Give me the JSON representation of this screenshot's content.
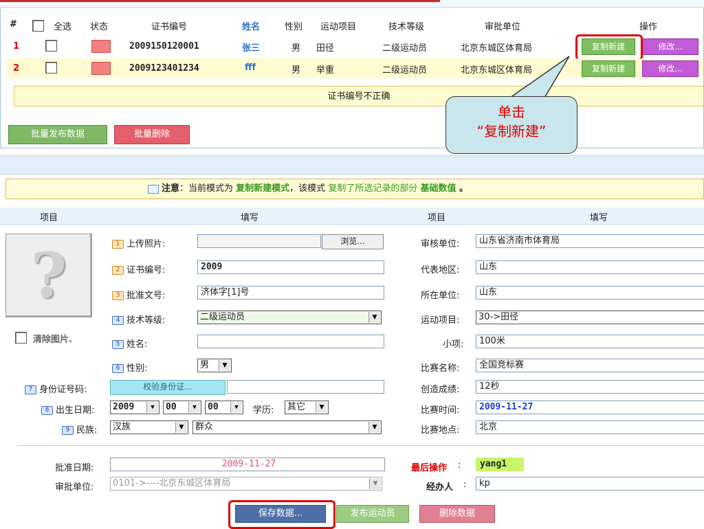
{
  "list": {
    "headers": [
      "#",
      "全选",
      "状态",
      "证书编号",
      "姓名",
      "性别",
      "运动项目",
      "技术等级",
      "审批单位",
      "操作"
    ],
    "rows": [
      {
        "index": "1",
        "cert": "2009150120001",
        "name": "张三",
        "gender": "男",
        "sport": "田径",
        "level": "二级运动员",
        "unit": "北京东城区体育局",
        "copy_btn": "复制新建",
        "edit_btn": "修改..."
      },
      {
        "index": "2",
        "cert": "2009123401234",
        "name": "fff",
        "gender": "男",
        "sport": "举重",
        "level": "二级运动员",
        "unit": "北京东城区体育局",
        "copy_btn": "复制新建",
        "edit_btn": "修改..."
      }
    ],
    "error_message": "证书编号不正确",
    "batch_publish": "批量发布数据",
    "batch_delete": "批量删除"
  },
  "callout": {
    "line1": "单击",
    "line2": "“复制新建”"
  },
  "notice": {
    "prefix": "注意",
    "text1": "：当前模式为 ",
    "mode": "复制新建模式",
    "text2": "，该模式 ",
    "text3": "复制了所选记录的部分 ",
    "highlight": "基础数值",
    "suffix": " 。"
  },
  "form_header": {
    "item_left": "项目",
    "fill_left": "填写",
    "item_right": "项目",
    "fill_right": "填写"
  },
  "form": {
    "upload_label": "上传照片:",
    "browse": "浏览...",
    "cert_label": "证书编号:",
    "cert_value": "2009",
    "approval_no_label": "批准文号:",
    "approval_no_value": "济体字[1]号",
    "tech_level_label": "技术等级:",
    "tech_level_value": "二级运动员",
    "clear_photo": "清除图片.",
    "name_label": "姓名:",
    "name_value": "",
    "gender_label": "性别:",
    "gender_value": "男",
    "id_label": "身份证号码:",
    "verify_btn": "校验身份证...",
    "birth_label": "出生日期:",
    "birth_year": "2009",
    "birth_month": "00",
    "birth_day": "00",
    "edu_label": "学历:",
    "edu_value": "其它",
    "ethnic_label": "民族:",
    "ethnic_value": "汉族",
    "political_value": "群众",
    "review_unit_label": "审核单位:",
    "review_unit_value": "山东省济南市体育局",
    "region_label": "代表地区:",
    "region_value": "山东",
    "org_label": "所在单位:",
    "org_value": "山东",
    "sport_label": "运动项目:",
    "sport_value": "30->田径",
    "sub_item_label": "小项:",
    "sub_item_value": "100米",
    "match_label": "比赛名称:",
    "match_value": "全国竞标赛",
    "score_label": "创造成绩:",
    "score_value": "12秒",
    "match_time_label": "比赛时间:",
    "match_time_value": "2009-11-27",
    "venue_label": "比赛地点:",
    "venue_value": "北京",
    "approve_date_label": "批准日期:",
    "approve_date_value": "2009-11-27",
    "approve_unit_label": "审批单位:",
    "approve_unit_value": "0101->----北京东城区体育局",
    "last_op_label": "最后操作",
    "last_op_value": "yang1",
    "handler_label": "经办人",
    "handler_value": "kp"
  },
  "actions": {
    "save": "保存数据...",
    "publish": "发布运动员",
    "delete": "删除数据"
  },
  "colors": {
    "accent_red": "#e00000",
    "green": "#7fbf5f",
    "purple": "#c15bd6",
    "yellow_row": "#fffbd0"
  }
}
